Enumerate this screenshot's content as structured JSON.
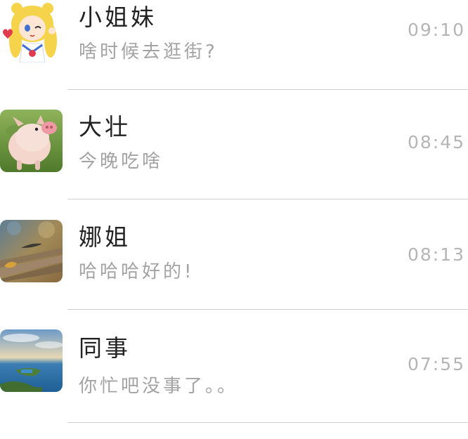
{
  "chats": [
    {
      "name": "小姐妹",
      "preview": "啥时候去逛街?",
      "time": "09:10",
      "avatar_icon": "sailor-moon-avatar-icon"
    },
    {
      "name": "大壮",
      "preview": "今晚吃啥",
      "time": "08:45",
      "avatar_icon": "piglet-avatar-icon"
    },
    {
      "name": "娜姐",
      "preview": "哈哈哈好的!",
      "time": "08:13",
      "avatar_icon": "autumn-bench-avatar-icon"
    },
    {
      "name": "同事",
      "preview": "你忙吧没事了。。",
      "time": "07:55",
      "avatar_icon": "lake-island-avatar-icon"
    }
  ],
  "colors": {
    "name_text": "#222222",
    "preview_text": "#a3a3a3",
    "time_text": "#b5b5b5",
    "divider": "#cfcfcf"
  }
}
